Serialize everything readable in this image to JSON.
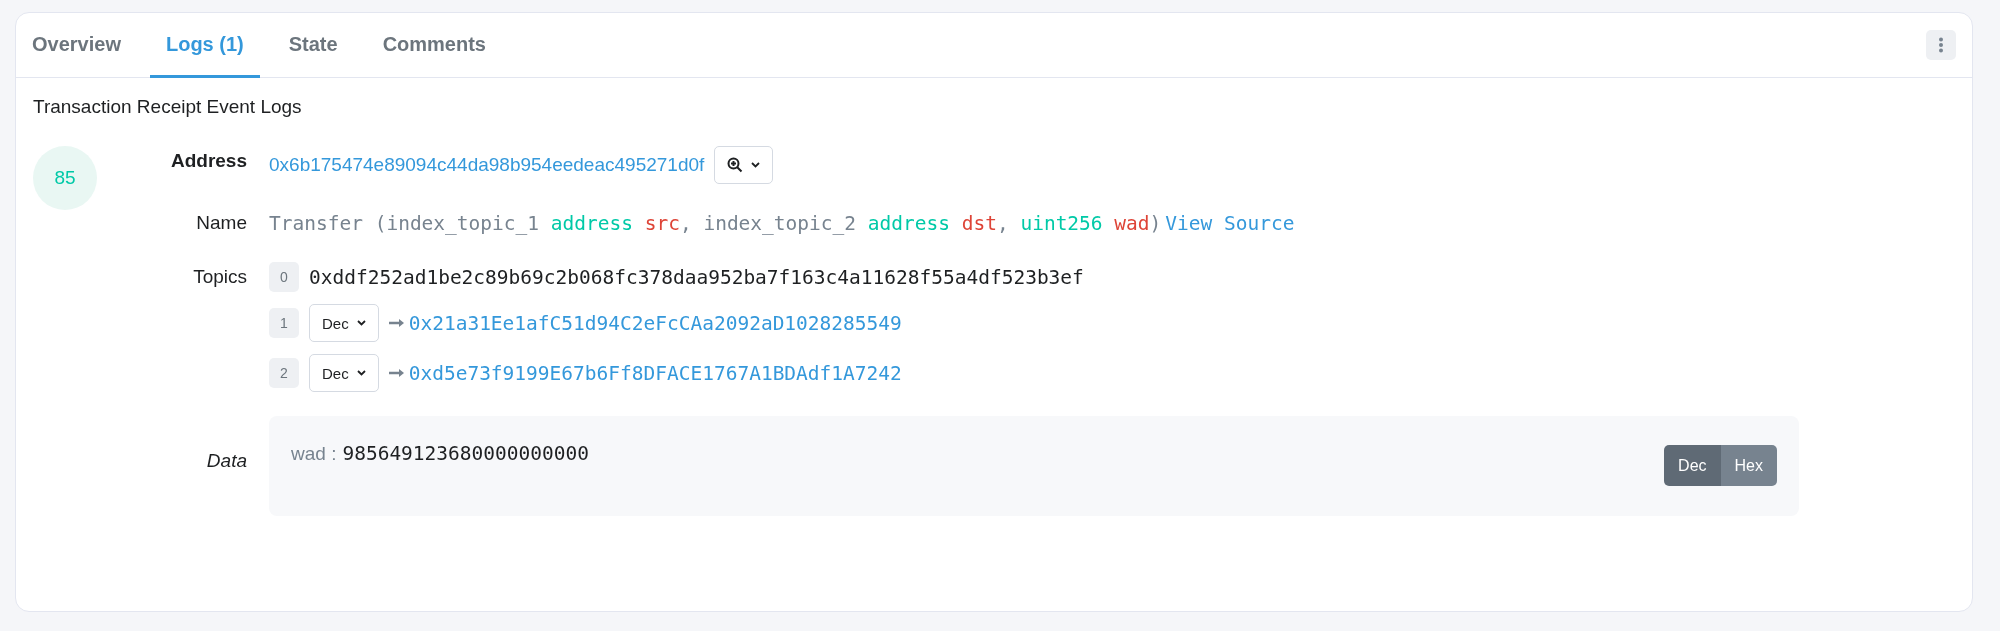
{
  "tabs": [
    {
      "label": "Overview",
      "selected": false
    },
    {
      "label": "Logs (1)",
      "selected": true
    },
    {
      "label": "State",
      "selected": false
    },
    {
      "label": "Comments",
      "selected": false
    }
  ],
  "section_title": "Transaction Receipt Event Logs",
  "logs": [
    {
      "index": "85",
      "address_label": "Address",
      "address": "0x6b175474e89094c44da98b954eedeac495271d0f",
      "name_label": "Name",
      "signature": [
        {
          "kind": "plain",
          "text": "Transfer (index_topic_1 "
        },
        {
          "kind": "type",
          "text": "address"
        },
        {
          "kind": "param",
          "text": " src"
        },
        {
          "kind": "plain",
          "text": ", index_topic_2 "
        },
        {
          "kind": "type",
          "text": "address"
        },
        {
          "kind": "param",
          "text": " dst"
        },
        {
          "kind": "plain",
          "text": ", "
        },
        {
          "kind": "type",
          "text": "uint256"
        },
        {
          "kind": "param",
          "text": " wad"
        },
        {
          "kind": "plain",
          "text": ")"
        }
      ],
      "view_source": "View Source",
      "topics_label": "Topics",
      "topics": [
        {
          "index": "0",
          "kind": "raw",
          "value": "0xddf252ad1be2c89b69c2b068fc378daa952ba7f163c4a11628f55a4df523b3ef"
        },
        {
          "index": "1",
          "kind": "decoded",
          "format": "Dec",
          "value": "0x21a31Ee1afC51d94C2eFcCAa2092aD1028285549"
        },
        {
          "index": "2",
          "kind": "decoded",
          "format": "Dec",
          "value": "0xd5e73f9199E67b6Ff8DFACE1767A1BDAdf1A7242"
        }
      ],
      "data_label": "Data",
      "data": [
        {
          "name": "wad :",
          "value": "985649123680000000000"
        }
      ],
      "formats": [
        {
          "label": "Dec",
          "selected": true
        },
        {
          "label": "Hex",
          "selected": false
        }
      ]
    }
  ]
}
